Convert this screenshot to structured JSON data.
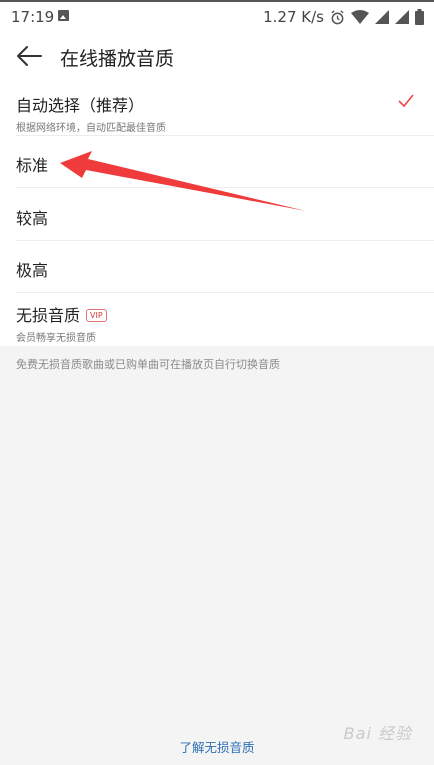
{
  "status_bar": {
    "time": "17:19",
    "network_speed": "1.27 K/s",
    "icons": [
      "image-icon",
      "alarm-icon",
      "wifi-icon",
      "signal-icon",
      "battery-icon"
    ]
  },
  "header": {
    "title": "在线播放音质",
    "back_icon": "back-arrow-icon"
  },
  "options": [
    {
      "label": "自动选择（推荐）",
      "sub": "根据网络环境，自动匹配最佳音质",
      "selected": true
    },
    {
      "label": "标准",
      "sub": "",
      "selected": false
    },
    {
      "label": "较高",
      "sub": "",
      "selected": false
    },
    {
      "label": "极高",
      "sub": "",
      "selected": false
    },
    {
      "label": "无损音质",
      "badge": "VIP",
      "sub": "会员畅享无损音质",
      "selected": false
    }
  ],
  "hint_text": "免费无损音质歌曲或已购单曲可在播放页自行切换音质",
  "bottom_link": "了解无损音质",
  "watermark": "Bai 经验",
  "colors": {
    "accent": "#e94b4b",
    "link": "#2f6fb4",
    "arrow": "#ef3b3b"
  }
}
